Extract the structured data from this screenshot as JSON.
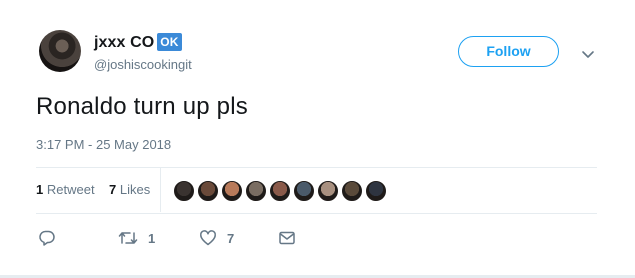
{
  "user": {
    "name": "jxxx CO",
    "badge": "OK",
    "handle": "@joshiscookingit"
  },
  "follow_button": {
    "label": "Follow"
  },
  "tweet": {
    "text": "Ronaldo turn up pls",
    "timestamp": "3:17 PM - 25 May 2018"
  },
  "stats": {
    "retweets_count": "1",
    "retweets_label": "Retweet",
    "likes_count": "7",
    "likes_label": "Likes"
  },
  "liker_avatars": [
    {
      "icon": "avatar-1",
      "color": "#3a3330"
    },
    {
      "icon": "avatar-2",
      "color": "#6a4a3a"
    },
    {
      "icon": "avatar-3",
      "color": "#b87a5a"
    },
    {
      "icon": "avatar-4",
      "color": "#7a6d62"
    },
    {
      "icon": "avatar-5",
      "color": "#8a5a4a"
    },
    {
      "icon": "avatar-6",
      "color": "#4a5a6a"
    },
    {
      "icon": "avatar-7",
      "color": "#a89080"
    },
    {
      "icon": "avatar-8",
      "color": "#5a4a3a"
    },
    {
      "icon": "avatar-9",
      "color": "#2e3440"
    }
  ],
  "actions": {
    "reply": {
      "icon": "reply-icon"
    },
    "retweet": {
      "icon": "retweet-icon",
      "count": "1"
    },
    "like": {
      "icon": "heart-icon",
      "count": "7"
    },
    "dm": {
      "icon": "envelope-icon"
    }
  },
  "colors": {
    "accent": "#1da1f2",
    "secondary_text": "#657786",
    "primary_text": "#14171a",
    "badge": "#3b8ad8"
  }
}
